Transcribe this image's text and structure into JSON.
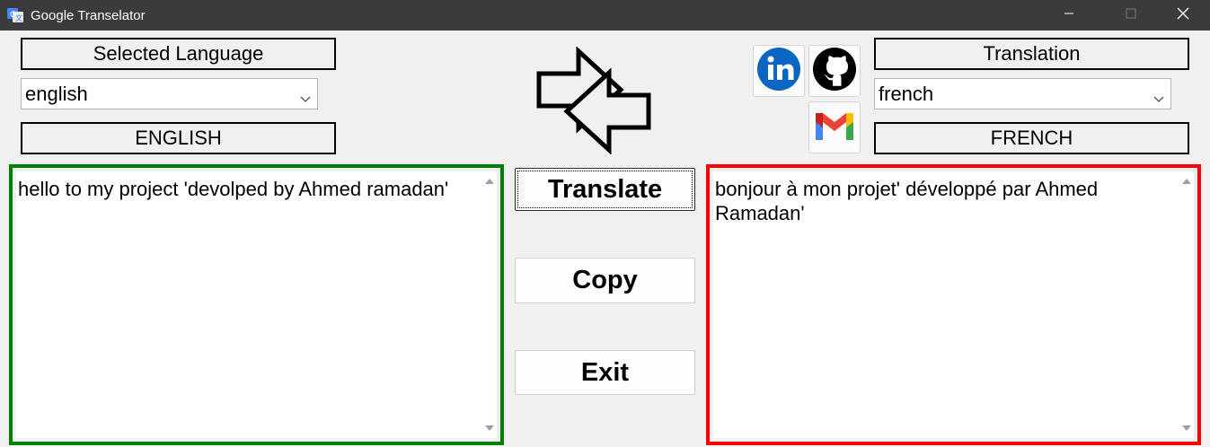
{
  "window": {
    "title": "Google Transelator"
  },
  "source": {
    "header": "Selected Language",
    "select_value": "english",
    "code_label": "ENGLISH",
    "text": "hello to my project 'devolped by Ahmed ramadan'",
    "border_color": "#008000"
  },
  "target": {
    "header": "Translation",
    "select_value": "french",
    "code_label": "FRENCH",
    "text": "bonjour à mon projet' développé par Ahmed Ramadan'",
    "border_color": "#ff0000"
  },
  "buttons": {
    "translate": "Translate",
    "copy": "Copy",
    "exit": "Exit"
  },
  "icons": {
    "app": "translate-icon",
    "swap": "swap-arrows-icon",
    "linkedin": "linkedin-icon",
    "github": "github-icon",
    "gmail": "gmail-icon"
  }
}
